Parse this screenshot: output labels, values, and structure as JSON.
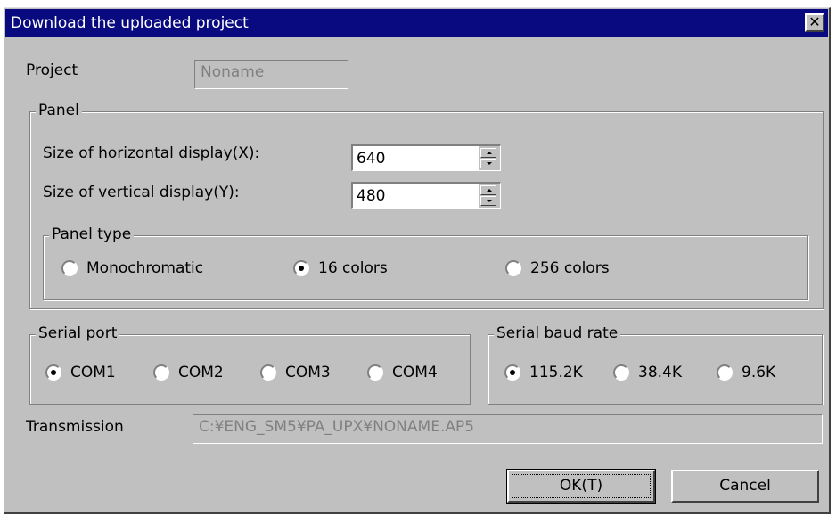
{
  "window": {
    "title": "Download the uploaded project",
    "close_label": "✕"
  },
  "project": {
    "label": "Project",
    "value": "Noname"
  },
  "panel": {
    "group_label": "Panel",
    "horizontal": {
      "label": "Size of horizontal display(X):",
      "value": "640"
    },
    "vertical": {
      "label": "Size of vertical display(Y):",
      "value": "480"
    },
    "panel_type": {
      "group_label": "Panel type",
      "options": [
        "Monochromatic",
        "16 colors",
        "256 colors"
      ],
      "selected": "16 colors"
    }
  },
  "serial_port": {
    "group_label": "Serial port",
    "options": [
      "COM1",
      "COM2",
      "COM3",
      "COM4"
    ],
    "selected": "COM1"
  },
  "baud_rate": {
    "group_label": "Serial baud rate",
    "options": [
      "115.2K",
      "38.4K",
      "9.6K"
    ],
    "selected": "115.2K"
  },
  "transmission": {
    "label": "Transmission",
    "value": "C:¥ENG_SM5¥PA_UPX¥NONAME.AP5"
  },
  "buttons": {
    "ok": "OK(T)",
    "cancel": "Cancel"
  },
  "colors": {
    "titlebar": "#0a0a80",
    "face": "#c0c0c0"
  }
}
